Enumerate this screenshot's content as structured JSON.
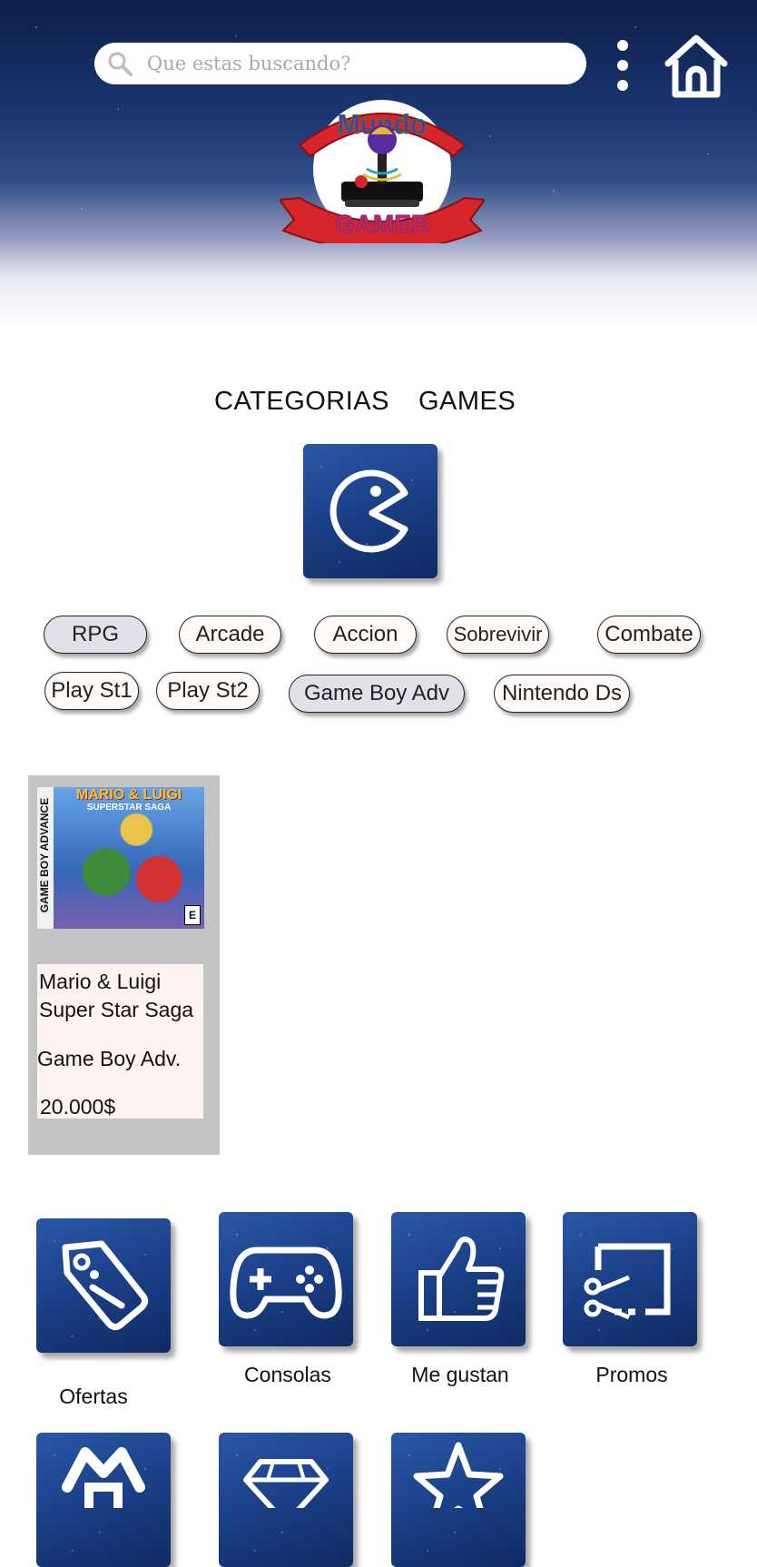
{
  "header": {
    "search": {
      "placeholder": "Que estas buscando?"
    },
    "icons": {
      "search": "search-icon",
      "menu": "more-vertical-icon",
      "home": "home-icon"
    },
    "logo": {
      "top_word": "Mundo",
      "bottom_word": "GAMER",
      "icon": "joystick-icon"
    }
  },
  "tabs": [
    "CATEGORIAS",
    "GAMES"
  ],
  "category_icon": "pacman-icon",
  "chips": [
    {
      "label": "RPG",
      "selected": true
    },
    {
      "label": "Arcade",
      "selected": false
    },
    {
      "label": "Accion",
      "selected": false
    },
    {
      "label": "Sobrevivir",
      "selected": false
    },
    {
      "label": "Combate",
      "selected": false
    },
    {
      "label": "Play St1",
      "selected": false
    },
    {
      "label": "Play St2",
      "selected": false
    },
    {
      "label": "Game Boy Adv",
      "selected": true
    },
    {
      "label": "Nintendo Ds",
      "selected": false
    }
  ],
  "product": {
    "cover": {
      "title": "MARIO & LUIGI",
      "subtitle": "SUPERSTAR SAGA",
      "spine": "GAME BOY ADVANCE",
      "rating": "E"
    },
    "name_line1": "Mario & Luigi",
    "name_line2": "Super Star Saga",
    "platform": "Game Boy Adv.",
    "price": "20.000$"
  },
  "bottom_nav": [
    {
      "label": "Ofertas",
      "icon": "tag-icon"
    },
    {
      "label": "Consolas",
      "icon": "gamepad-icon"
    },
    {
      "label": "Me gustan",
      "icon": "thumbs-up-icon"
    },
    {
      "label": "Promos",
      "icon": "cast-icon"
    }
  ],
  "bottom_nav_row2_icons": [
    "brand-icon",
    "diamond-icon",
    "star-icon"
  ],
  "colors": {
    "tile_blue": "#1a3f86",
    "chip_bg": "#fff9f8",
    "chip_selected_bg": "#e1e1ea",
    "card_bg": "#c4c4c4",
    "info_bg": "#fff3f1"
  }
}
